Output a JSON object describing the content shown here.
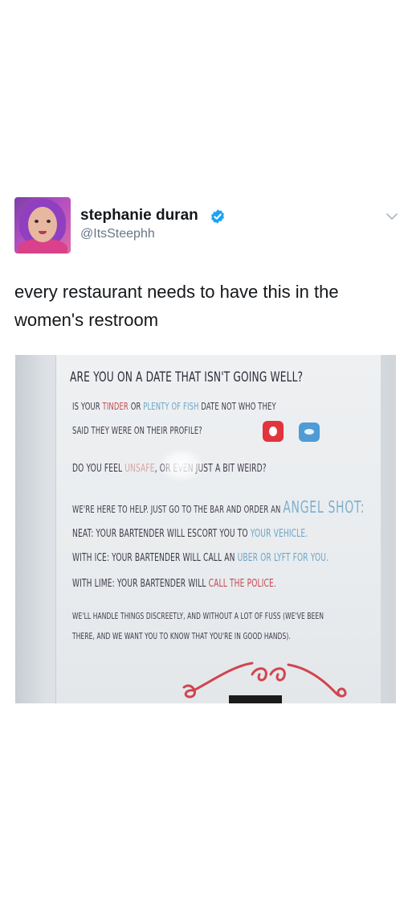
{
  "tweet": {
    "author": {
      "display_name": "stephanie duran",
      "handle": "@ItsSteephh",
      "verified": true,
      "avatar": "avatar-photo"
    },
    "text": "every restaurant needs to have this in the women's restroom",
    "icons": {
      "verified": "verified-badge-icon",
      "menu": "chevron-down-icon"
    },
    "colors": {
      "verified_blue": "#1da1f2",
      "handle_gray": "#657786"
    }
  },
  "photo": {
    "sign": {
      "heading": "ARE YOU ON A DATE THAT ISN'T GOING WELL?",
      "line2": {
        "a": "IS YOUR ",
        "tinder": "TINDER",
        "b": " OR ",
        "pof": "PLENTY OF FISH",
        "c": " DATE NOT WHO THEY"
      },
      "line3": "SAID THEY WERE ON THEIR PROFILE?",
      "line4": {
        "a": "DO YOU FEEL ",
        "unsafe": "UNSAFE",
        "b": ", OR EVEN JUST A BIT WEIRD?"
      },
      "line5": {
        "a": "WE'RE HERE TO HELP. JUST GO TO THE BAR AND ORDER AN ",
        "angel": "ANGEL SHOT:"
      },
      "neat": {
        "a": "NEAT: YOUR BARTENDER WILL ESCORT YOU TO ",
        "b": "YOUR VEHICLE."
      },
      "ice": {
        "a": "WITH ICE: YOUR BARTENDER WILL CALL AN ",
        "b": "UBER OR LYFT FOR YOU."
      },
      "lime": {
        "a": "WITH LIME: YOUR BARTENDER WILL ",
        "b": "CALL THE POLICE."
      },
      "closing1": "WE'LL HANDLE THINGS DISCREETLY, AND WITHOUT A LOT OF FUSS (WE'VE BEEN",
      "closing2": "THERE, AND WE WANT YOU TO KNOW THAT YOU'RE IN GOOD HANDS).",
      "icons": [
        "tinder-app-icon",
        "plenty-of-fish-app-icon"
      ],
      "colors": {
        "text": "#3f3a4a",
        "red_highlight": "#c24b52",
        "blue_highlight": "#6fa6c8",
        "flourish": "#d0454f"
      }
    }
  }
}
